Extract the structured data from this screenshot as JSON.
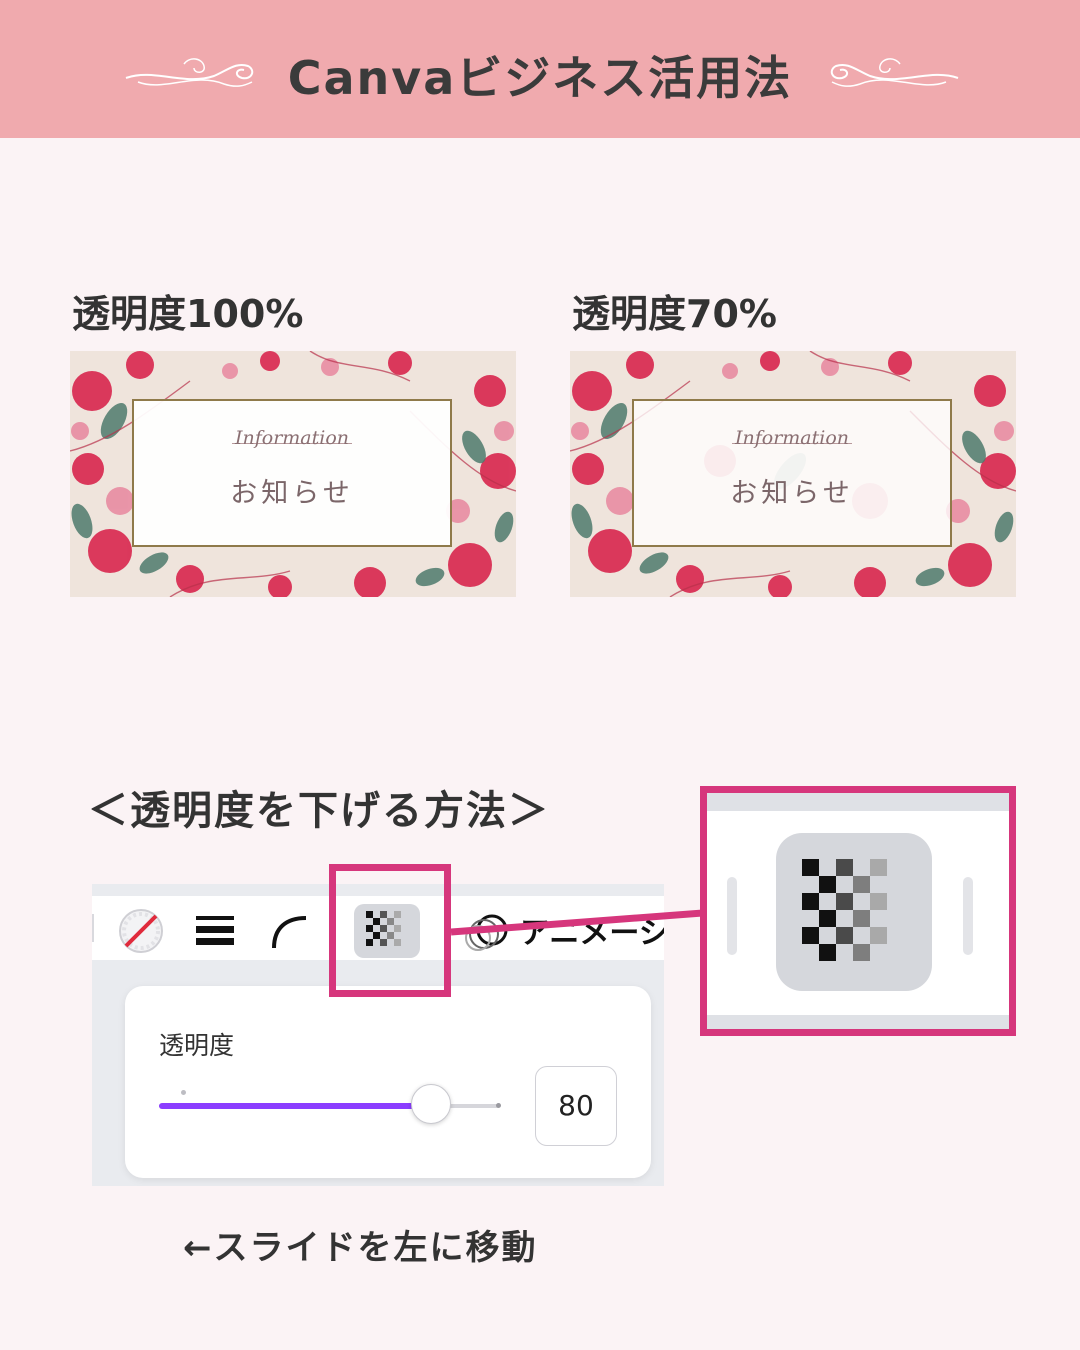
{
  "header": {
    "title": "Canvaビジネス活用法"
  },
  "examples": [
    {
      "caption": "透明度100%",
      "card_script": "Information",
      "card_title": "お知らせ"
    },
    {
      "caption": "透明度70%",
      "card_script": "Information",
      "card_title": "お知らせ"
    }
  ],
  "method": {
    "title": "＜透明度を下げる方法＞"
  },
  "toolbar": {
    "animate_label": "アニメーシ",
    "icons": [
      "color-icon",
      "line-weight-icon",
      "corner-radius-icon",
      "transparency-icon",
      "animate-icon"
    ]
  },
  "transparency_popup": {
    "label": "透明度",
    "value": "80",
    "slider_percent": 80
  },
  "note": "←スライドを左に移動",
  "colors": {
    "header_bg": "#f0aaae",
    "page_bg": "#fbf3f5",
    "highlight": "#d6367c",
    "slider_fill": "#8b3dff"
  }
}
